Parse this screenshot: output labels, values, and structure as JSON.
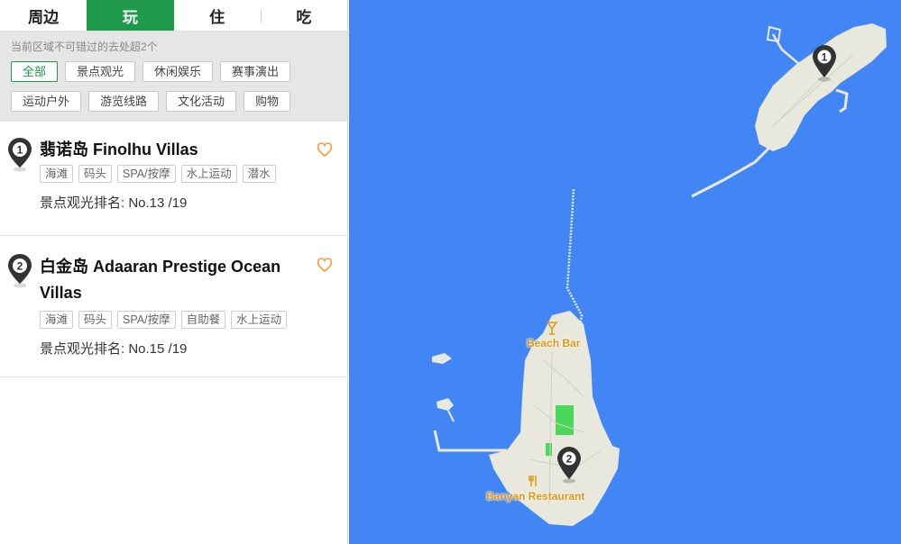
{
  "tabs": [
    {
      "label": "周边"
    },
    {
      "label": "玩",
      "active": true
    },
    {
      "label": "住"
    },
    {
      "label": "吃"
    }
  ],
  "filters": {
    "hint": "当前区域不可错过的去处超2个",
    "chips": [
      {
        "label": "全部",
        "active": true
      },
      {
        "label": "景点观光"
      },
      {
        "label": "休闲娱乐"
      },
      {
        "label": "赛事演出"
      },
      {
        "label": "运动户外"
      },
      {
        "label": "游览线路"
      },
      {
        "label": "文化活动"
      },
      {
        "label": "购物"
      }
    ]
  },
  "results": [
    {
      "index": "1",
      "title": "翡诺岛 Finolhu Villas",
      "tags": [
        "海滩",
        "码头",
        "SPA/按摩",
        "水上运动",
        "潜水"
      ],
      "rank_label": "景点观光排名:",
      "rank_value": "No.13 /19"
    },
    {
      "index": "2",
      "title": "白金岛 Adaaran Prestige Ocean Villas",
      "tags": [
        "海滩",
        "码头",
        "SPA/按摩",
        "自助餐",
        "水上运动"
      ],
      "rank_label": "景点观光排名:",
      "rank_value": "No.15 /19"
    }
  ],
  "map": {
    "labels": {
      "beach_bar": "Beach Bar",
      "restaurant": "Banyan Restaurant"
    },
    "markers": [
      "1",
      "2"
    ],
    "colors": {
      "water": "#4286f5",
      "land": "#e8e8dc",
      "park": "#4bd85a",
      "poi": "#e39512",
      "marker": "#333333"
    }
  }
}
